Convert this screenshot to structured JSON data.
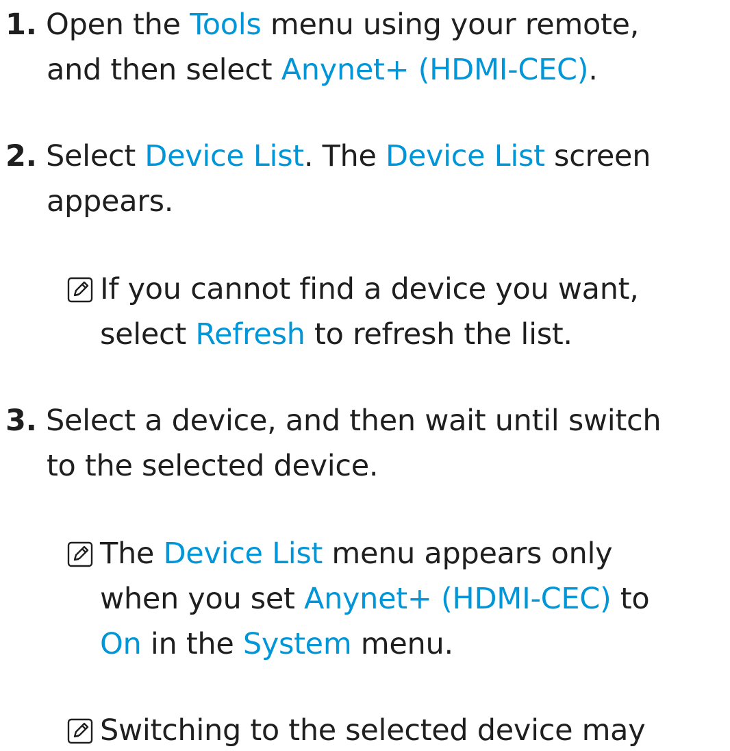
{
  "steps": [
    {
      "number": "1.",
      "line1": [
        {
          "t": "Open the "
        },
        {
          "t": "Tools",
          "hl": true
        },
        {
          "t": " menu using your remote,"
        }
      ],
      "line2": [
        {
          "t": "and then select "
        },
        {
          "t": "Anynet+ (HDMI-CEC)",
          "hl": true
        },
        {
          "t": "."
        }
      ]
    },
    {
      "number": "2.",
      "line1": [
        {
          "t": "Select "
        },
        {
          "t": "Device List",
          "hl": true
        },
        {
          "t": ". The "
        },
        {
          "t": "Device List",
          "hl": true
        },
        {
          "t": " screen"
        }
      ],
      "line2": [
        {
          "t": "appears."
        }
      ],
      "notes": [
        {
          "icon": "note-icon",
          "line1": [
            {
              "t": "If you cannot find a device you want,"
            }
          ],
          "line2": [
            {
              "t": "select "
            },
            {
              "t": "Refresh",
              "hl": true
            },
            {
              "t": " to refresh the list."
            }
          ]
        }
      ]
    },
    {
      "number": "3.",
      "line1": [
        {
          "t": "Select a device, and then wait until switch"
        }
      ],
      "line2": [
        {
          "t": "to the selected device."
        }
      ],
      "notes": [
        {
          "icon": "note-icon",
          "line1": [
            {
              "t": "The "
            },
            {
              "t": "Device List",
              "hl": true
            },
            {
              "t": " menu appears only"
            }
          ],
          "line2": [
            {
              "t": "when you set "
            },
            {
              "t": "Anynet+ (HDMI-CEC)",
              "hl": true
            },
            {
              "t": " to"
            }
          ],
          "line3": [
            {
              "t": "On",
              "hl": true
            },
            {
              "t": " in the "
            },
            {
              "t": "System",
              "hl": true
            },
            {
              "t": " menu."
            }
          ]
        },
        {
          "icon": "note-icon",
          "line1": [
            {
              "t": "Switching to the selected device may"
            }
          ]
        }
      ]
    }
  ],
  "colors": {
    "text": "#1f1f1f",
    "highlight": "#0096d8"
  }
}
